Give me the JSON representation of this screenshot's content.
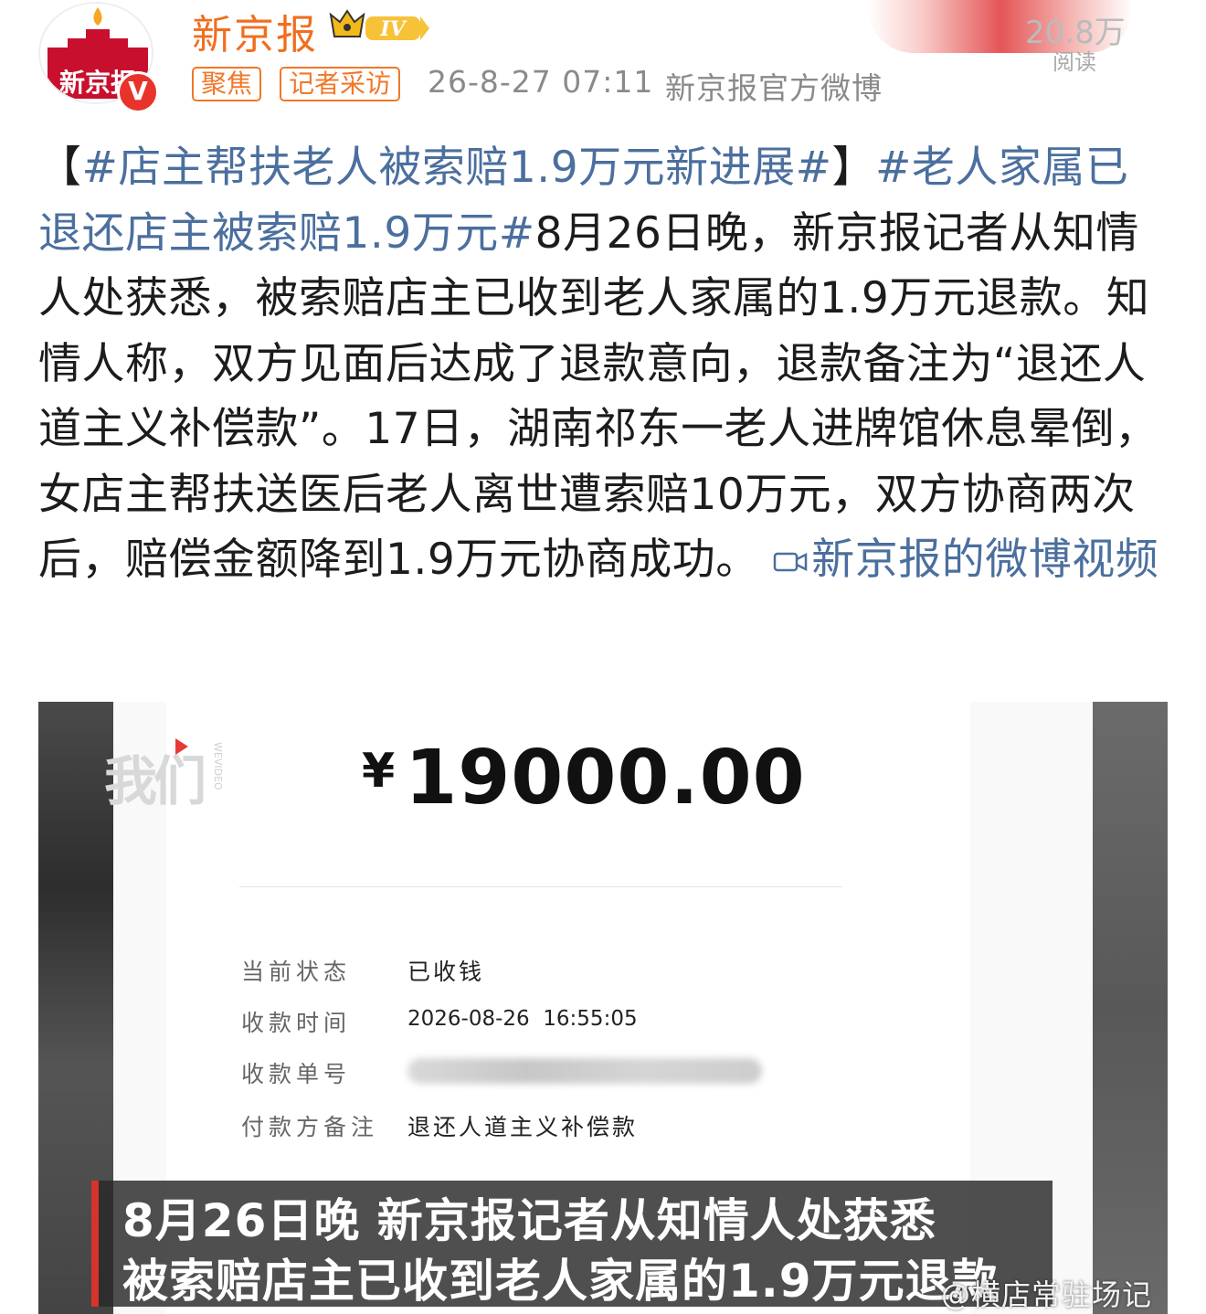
{
  "author": {
    "name": "新京报",
    "avatar_text": "新京报",
    "verified_mark": "V",
    "level_badge": "IV"
  },
  "tags": [
    "聚焦",
    "记者采访"
  ],
  "meta": {
    "time": "26-8-27 07:11",
    "source": "新京报官方微博",
    "read_count": "20.8万",
    "read_label": "阅读"
  },
  "post": {
    "hashtag1": "#店主帮扶老人被索赔1.9万元新进展#",
    "hashtag2": "#老人家属已退还店主被索赔1.9万元#",
    "bracket_open": "【",
    "bracket_close": "】",
    "body": "8月26日晚，新京报记者从知情人处获悉，被索赔店主已收到老人家属的1.9万元退款。知情人称，双方见面后达成了退款意向，退款备注为“退还人道主义补偿款”。17日，湖南祁东一老人进牌馆休息晕倒，女店主帮扶送医后老人离世遭索赔10万元，双方协商两次后，赔偿金额降到1.9万元协商成功。",
    "video_link": "新京报的微博视频"
  },
  "media": {
    "watermark": "我们",
    "watermark_sub": "WEVIDEO",
    "amount_symbol": "¥",
    "amount": "19000.00",
    "rows": [
      {
        "label": "当前状态",
        "value": "已收钱"
      },
      {
        "label": "收款时间",
        "value": "2026-08-26  16:55:05"
      },
      {
        "label": "收款单号",
        "value": ""
      },
      {
        "label": "付款方备注",
        "value": "退还人道主义补偿款"
      }
    ],
    "subtitle_line1": "8月26日晚 新京报记者从知情人处获悉",
    "subtitle_line2": "被索赔店主已收到老人家属的1.9万元退款"
  },
  "weibo_watermark": "@横店常驻场记",
  "colors": {
    "accent_orange": "#f07828",
    "link_blue": "#4b6f9e",
    "brand_red": "#d6332b"
  }
}
